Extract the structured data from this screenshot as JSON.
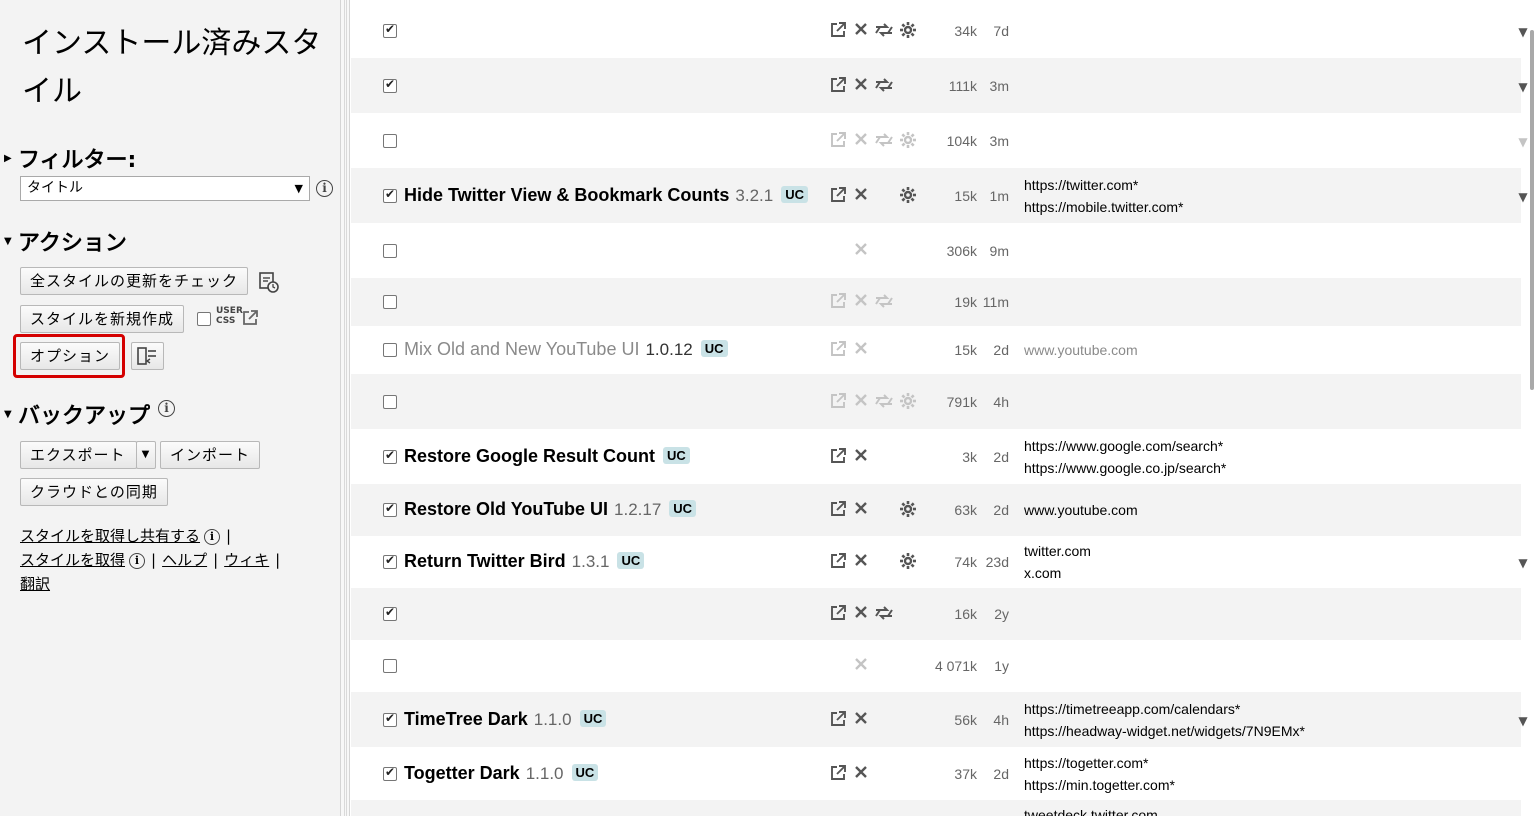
{
  "sidebar": {
    "title": "インストール済みスタイル",
    "filter": {
      "heading": "フィルター:",
      "select_value": "タイトル"
    },
    "actions": {
      "heading": "アクション",
      "check_updates": "全スタイルの更新をチェック",
      "new_style": "スタイルを新規作成",
      "usercss_label": "USER CSS",
      "options": "オプション"
    },
    "backup": {
      "heading": "バックアップ",
      "export": "エクスポート",
      "import": "インポート",
      "cloud_sync": "クラウドとの同期"
    },
    "links": {
      "get_share": "スタイルを取得し共有する",
      "get": "スタイルを取得",
      "help": "ヘルプ",
      "wiki": "ウィキ",
      "translate": "翻訳",
      "separator": "|"
    }
  },
  "styles": [
    {
      "enabled": true,
      "name": "",
      "version": "",
      "uc": false,
      "icons": [
        "edit-icon",
        "delete-icon",
        "update-icon",
        "config-icon"
      ],
      "size": "34k",
      "age": "7d",
      "sites": [],
      "expand": true
    },
    {
      "enabled": true,
      "name": "",
      "version": "",
      "uc": false,
      "icons": [
        "edit-icon",
        "delete-icon",
        "update-icon"
      ],
      "size": "111k",
      "age": "3m",
      "sites": [],
      "expand": true
    },
    {
      "enabled": false,
      "name": "",
      "version": "",
      "uc": false,
      "icons": [
        "edit-icon",
        "delete-icon",
        "update-icon",
        "config-icon"
      ],
      "size": "104k",
      "age": "3m",
      "sites": [],
      "expand": true
    },
    {
      "enabled": true,
      "name": "Hide Twitter View & Bookmark Counts",
      "version": "3.2.1",
      "uc": true,
      "icons": [
        "edit-icon",
        "delete-icon",
        "config-icon"
      ],
      "size": "15k",
      "age": "1m",
      "sites": [
        "https://twitter.com*",
        "https://mobile.twitter.com*"
      ],
      "expand": true
    },
    {
      "enabled": false,
      "name": "",
      "version": "",
      "uc": false,
      "icons": [
        "delete-icon"
      ],
      "size": "306k",
      "age": "9m",
      "sites": [],
      "expand": false
    },
    {
      "enabled": false,
      "name": "",
      "version": "",
      "uc": false,
      "icons": [
        "edit-icon",
        "delete-icon",
        "update-icon"
      ],
      "size": "19k",
      "age": "11m",
      "sites": [],
      "expand": false
    },
    {
      "enabled": false,
      "name": "Mix Old and New YouTube UI",
      "version": "1.0.12",
      "uc": true,
      "icons": [
        "edit-icon",
        "delete-icon"
      ],
      "size": "15k",
      "age": "2d",
      "sites": [
        "www.youtube.com"
      ],
      "expand": false
    },
    {
      "enabled": false,
      "name": "",
      "version": "",
      "uc": false,
      "icons": [
        "edit-icon",
        "delete-icon",
        "update-icon",
        "config-icon"
      ],
      "size": "791k",
      "age": "4h",
      "sites": [],
      "expand": false
    },
    {
      "enabled": true,
      "name": "Restore Google Result Count",
      "version": "",
      "uc": true,
      "icons": [
        "edit-icon",
        "delete-icon"
      ],
      "size": "3k",
      "age": "2d",
      "sites": [
        "https://www.google.com/search*",
        "https://www.google.co.jp/search*"
      ],
      "expand": false
    },
    {
      "enabled": true,
      "name": "Restore Old YouTube UI",
      "version": "1.2.17",
      "uc": true,
      "icons": [
        "edit-icon",
        "delete-icon",
        "config-icon"
      ],
      "size": "63k",
      "age": "2d",
      "sites": [
        "www.youtube.com"
      ],
      "expand": false
    },
    {
      "enabled": true,
      "name": "Return Twitter Bird",
      "version": "1.3.1",
      "uc": true,
      "icons": [
        "edit-icon",
        "delete-icon",
        "config-icon"
      ],
      "size": "74k",
      "age": "23d",
      "sites": [
        "twitter.com",
        "x.com"
      ],
      "expand": true
    },
    {
      "enabled": true,
      "name": "",
      "version": "",
      "uc": false,
      "icons": [
        "edit-icon",
        "delete-icon",
        "update-icon"
      ],
      "size": "16k",
      "age": "2y",
      "sites": [],
      "expand": false
    },
    {
      "enabled": false,
      "name": "",
      "version": "",
      "uc": false,
      "icons": [
        "delete-icon"
      ],
      "size": "4 071k",
      "age": "1y",
      "sites": [],
      "expand": false
    },
    {
      "enabled": true,
      "name": "TimeTree Dark",
      "version": "1.1.0",
      "uc": true,
      "icons": [
        "edit-icon",
        "delete-icon"
      ],
      "size": "56k",
      "age": "4h",
      "sites": [
        "https://timetreeapp.com/calendars*",
        "https://headway-widget.net/widgets/7N9EMx*"
      ],
      "expand": true
    },
    {
      "enabled": true,
      "name": "Togetter Dark",
      "version": "1.1.0",
      "uc": true,
      "icons": [
        "edit-icon",
        "delete-icon"
      ],
      "size": "37k",
      "age": "2d",
      "sites": [
        "https://togetter.com*",
        "https://min.togetter.com*"
      ],
      "expand": false
    },
    {
      "enabled": true,
      "name": "",
      "version": "",
      "uc": false,
      "icons": [],
      "size": "",
      "age": "",
      "sites": [
        "tweetdeck.twitter.com"
      ],
      "expand": false
    }
  ],
  "uc_label": "UC",
  "colors": {
    "highlight": "#d40000",
    "uc_badge": "#c9e2e6"
  }
}
